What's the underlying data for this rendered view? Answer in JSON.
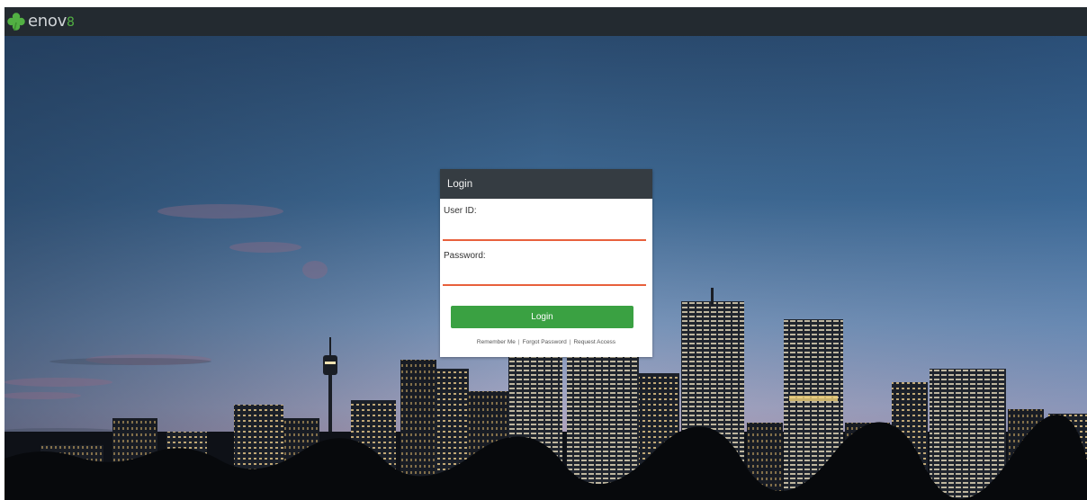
{
  "brand": {
    "name_main": "enov",
    "name_accent": "8",
    "accent_color": "#52b043"
  },
  "login": {
    "title": "Login",
    "user_id_label": "User ID:",
    "user_id_value": "",
    "password_label": "Password:",
    "password_value": "",
    "submit_label": "Login",
    "links": {
      "remember_me": "Remember Me",
      "forgot_password": "Forgot Password",
      "request_access": "Request Access",
      "separator": "|"
    }
  },
  "colors": {
    "topbar": "#232a30",
    "card_header": "#353c42",
    "input_underline": "#e8603c",
    "button": "#3aa142"
  }
}
